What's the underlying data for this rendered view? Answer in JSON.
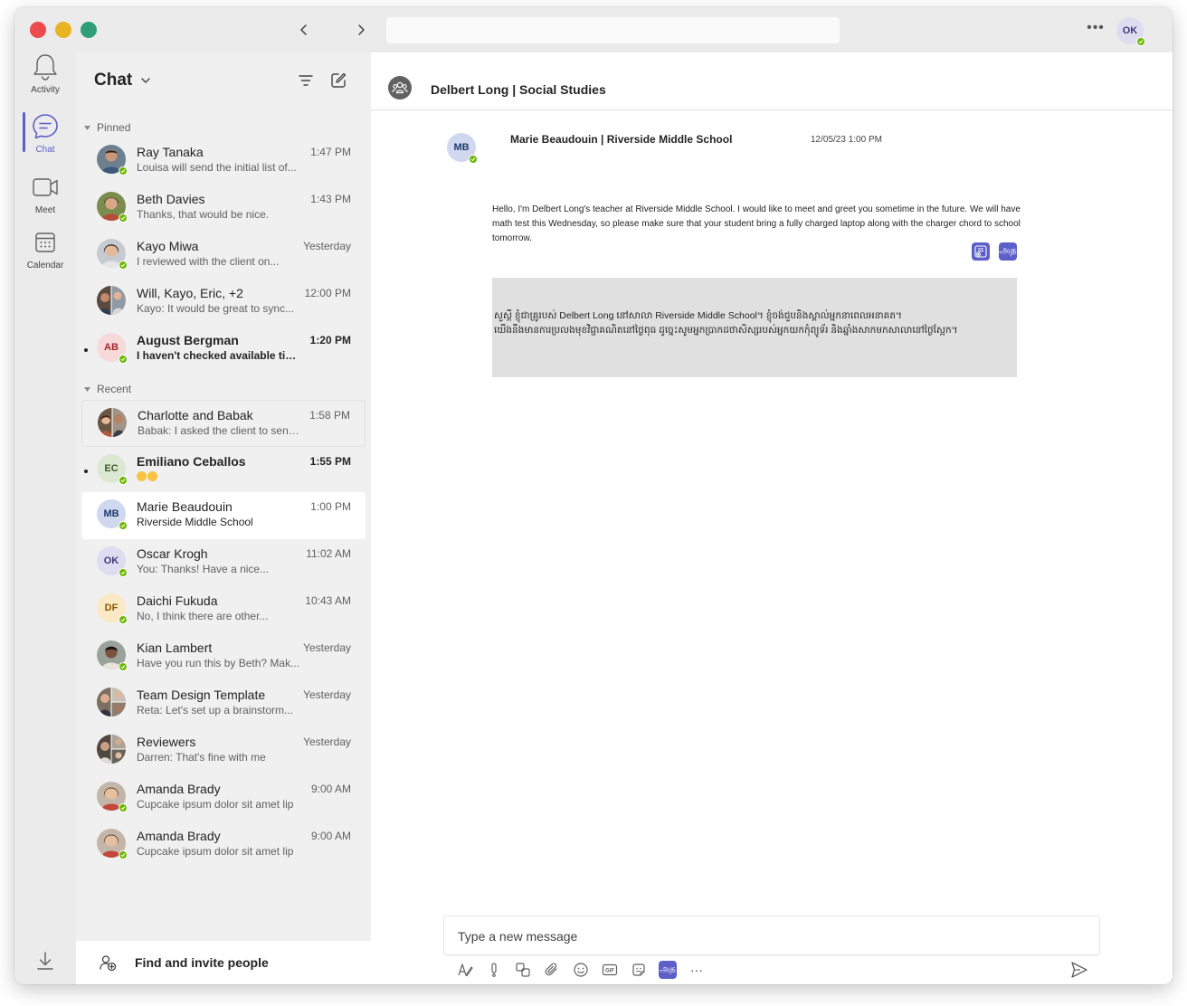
{
  "titlebar": {
    "search_placeholder": "",
    "more_label": "•••",
    "me_initials": "OK"
  },
  "rail": {
    "items": [
      {
        "label": "Activity",
        "icon": "bell-icon"
      },
      {
        "label": "Chat",
        "icon": "chat-icon"
      },
      {
        "label": "Meet",
        "icon": "video-icon"
      },
      {
        "label": "Calendar",
        "icon": "calendar-icon"
      }
    ]
  },
  "list": {
    "title": "Chat",
    "sections": {
      "pinned": "Pinned",
      "recent": "Recent"
    },
    "pinned": [
      {
        "name": "Ray Tanaka",
        "preview": "Louisa will send the initial list of...",
        "time": "1:47 PM"
      },
      {
        "name": "Beth Davies",
        "preview": "Thanks, that would be nice.",
        "time": "1:43 PM"
      },
      {
        "name": "Kayo Miwa",
        "preview": "I reviewed with the client on...",
        "time": "Yesterday"
      },
      {
        "name": "Will, Kayo, Eric, +2",
        "preview": "Kayo: It would be great to sync...",
        "time": "12:00 PM"
      },
      {
        "name": "August Bergman",
        "preview": "I haven't checked available time...",
        "time": "1:20 PM",
        "initials": "AB"
      }
    ],
    "recent": [
      {
        "name": "Charlotte and Babak",
        "preview": "Babak: I asked the client to send...",
        "time": "1:58 PM"
      },
      {
        "name": "Emiliano Ceballos",
        "preview": "",
        "time": "1:55 PM",
        "initials": "EC"
      },
      {
        "name": "Marie Beaudouin",
        "preview": "Riverside Middle School",
        "time": "1:00 PM",
        "initials": "MB"
      },
      {
        "name": "Oscar Krogh",
        "preview": "You: Thanks! Have a nice...",
        "time": "11:02 AM",
        "initials": "OK"
      },
      {
        "name": "Daichi Fukuda",
        "preview": "No, I think there are other...",
        "time": "10:43 AM",
        "initials": "DF"
      },
      {
        "name": "Kian Lambert",
        "preview": "Have you run this by Beth? Mak...",
        "time": "Yesterday"
      },
      {
        "name": "Team Design Template",
        "preview": "Reta: Let's set up a brainstorm...",
        "time": "Yesterday"
      },
      {
        "name": "Reviewers",
        "preview": "Darren: That's fine with me",
        "time": "Yesterday"
      },
      {
        "name": "Amanda Brady",
        "preview": "Cupcake ipsum dolor sit amet lip",
        "time": "9:00 AM"
      },
      {
        "name": "Amanda Brady",
        "preview": "Cupcake ipsum dolor sit amet lip",
        "time": "9:00 AM"
      }
    ],
    "find_label": "Find and invite people"
  },
  "chat": {
    "title": "Delbert Long | Social Studies",
    "message": {
      "initials": "MB",
      "sender": "Marie Beaudouin | Riverside Middle School",
      "time": "12/05/23 1:00 PM",
      "body": "Hello, I'm Delbert Long's teacher at Riverside Middle School. I would like to meet and greet you sometime in the future. We will have math test this Wednesday, so please make sure that your student bring a fully charged laptop along with the charger chord to school tomorrow.",
      "translate_glyph": "அத",
      "translation_line1": "សួស្តី ខ្ញុំជាគ្រូរបស់ Delbert Long នៅសាលា Riverside Middle School។ ខ្ញុំចង់ជួបនិងស្គាល់អ្នកនាពេលអនាគត។",
      "translation_line2": "យើងនឹងមានការប្រលងមុខវិជ្ជាគណិតនៅថ្ងៃពុធ ដូច្នេះសូមអ្នកប្រាកដថាសិស្សរបស់អ្នកយកកុំព្យូទ័រ និងឆ្នាំងសាកមកសាលានៅថ្ងៃស្អែក។"
    },
    "composer_placeholder": "Type a new message",
    "toolbar_translate_glyph": "அத",
    "toolbar_more": "···",
    "gif_label": "GIF"
  },
  "colors": {
    "accent": "#5b5fc7",
    "presence": "#6bb700",
    "rail_bg": "#ebebeb",
    "list_bg": "#f0f0f0"
  }
}
